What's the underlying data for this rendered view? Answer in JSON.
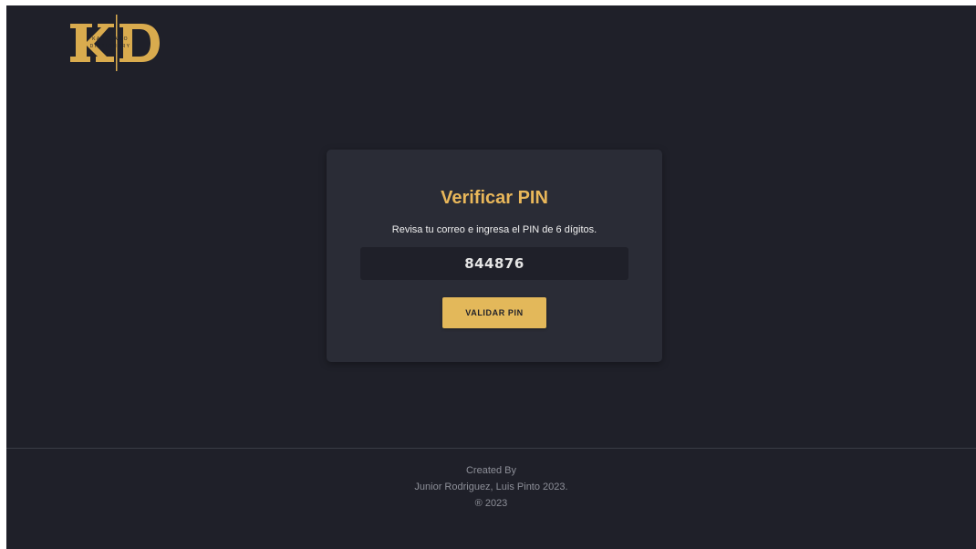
{
  "brand": {
    "logo_letters": "KD",
    "logo_line1": "KANKUAMO",
    "logo_line2": "DICTIONARY",
    "accent_color": "#e3b85a",
    "logo_icon": "kd-logo-icon"
  },
  "card": {
    "title": "Verificar PIN",
    "subtitle": "Revisa tu correo e ingresa el PIN de 6 dígitos.",
    "pin_value": "844876",
    "button_label": "VALIDAR PIN"
  },
  "footer": {
    "line1": "Created By",
    "line2": "Junior Rodriguez, Luis Pinto 2023.",
    "line3": "® 2023"
  },
  "colors": {
    "background": "#1f2029",
    "card": "#2a2c36",
    "title": "#e9b75a"
  }
}
